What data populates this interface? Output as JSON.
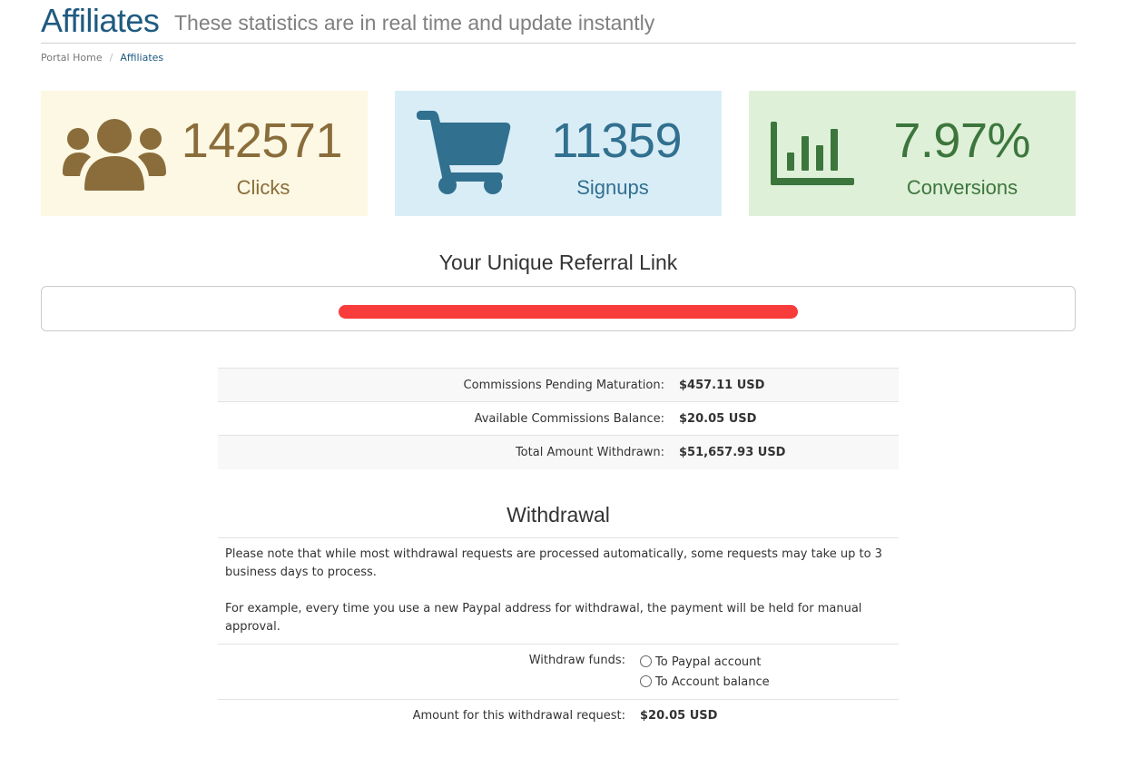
{
  "header": {
    "title": "Affiliates",
    "subtitle": "These statistics are in real time and update instantly"
  },
  "breadcrumb": {
    "home": "Portal Home",
    "separator": "/",
    "current": "Affiliates"
  },
  "stats": {
    "clicks": {
      "value": "142571",
      "label": "Clicks",
      "icon": "users-icon",
      "color": "#8a6d3b",
      "bg": "#fcf8e3"
    },
    "signups": {
      "value": "11359",
      "label": "Signups",
      "icon": "shopping-cart-icon",
      "color": "#31708f",
      "bg": "#d9edf7"
    },
    "conversions": {
      "value": "7.97%",
      "label": "Conversions",
      "icon": "bar-chart-icon",
      "color": "#3c763d",
      "bg": "#dff0d8"
    }
  },
  "referral": {
    "heading": "Your Unique Referral Link"
  },
  "commissions": [
    {
      "label": "Commissions Pending Maturation:",
      "value": "$457.11 USD"
    },
    {
      "label": "Available Commissions Balance:",
      "value": "$20.05 USD"
    },
    {
      "label": "Total Amount Withdrawn:",
      "value": "$51,657.93 USD"
    }
  ],
  "withdrawal": {
    "heading": "Withdrawal",
    "note1": "Please note that while most withdrawal requests are processed automatically, some requests may take up to 3 business days to process.",
    "note2": "For example, every time you use a new Paypal address for withdrawal, the payment will be held for manual approval.",
    "funds_label": "Withdraw funds:",
    "option_paypal": "To Paypal account",
    "option_balance": "To Account balance",
    "amount_label": "Amount for this withdrawal request:",
    "amount_value": "$20.05 USD"
  }
}
